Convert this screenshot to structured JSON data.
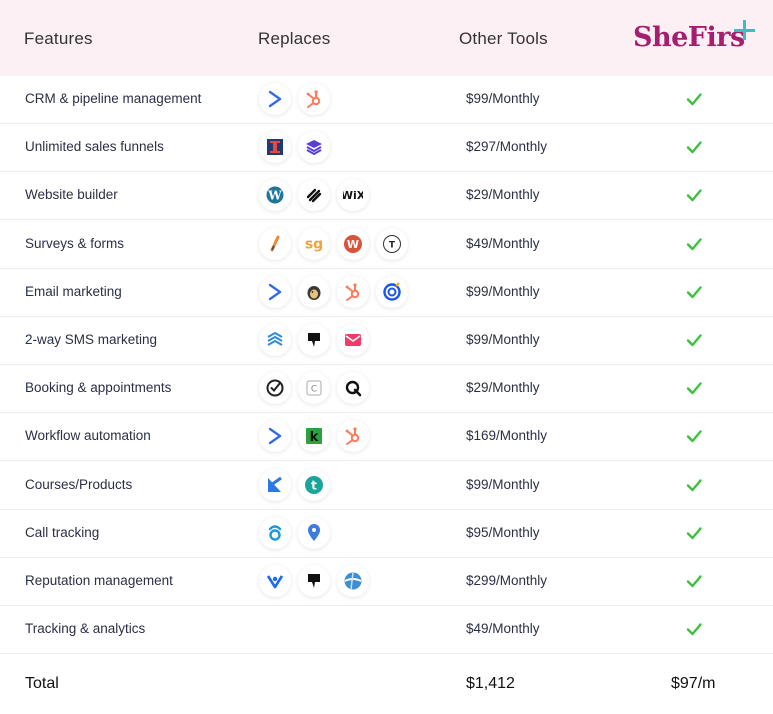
{
  "header": {
    "features": "Features",
    "replaces": "Replaces",
    "other_tools": "Other Tools",
    "brand": "SheFirs"
  },
  "colors": {
    "header_bg": "#fdf0f4",
    "brand": "#a61f6e",
    "plus": "#33c2bd",
    "check": "#3cc13b"
  },
  "rows": [
    {
      "feature": "CRM & pipeline management",
      "price": "$99/Monthly",
      "icons": [
        "activecampaign-icon",
        "hubspot-icon"
      ]
    },
    {
      "feature": "Unlimited sales funnels",
      "price": "$297/Monthly",
      "icons": [
        "clickfunnels-icon",
        "leadpages-icon"
      ]
    },
    {
      "feature": "Website builder",
      "price": "$29/Monthly",
      "icons": [
        "wordpress-icon",
        "squarespace-icon",
        "wix-icon"
      ]
    },
    {
      "feature": "Surveys & forms",
      "price": "$49/Monthly",
      "icons": [
        "jotform-icon",
        "surveygizmo-icon",
        "wufoo-icon",
        "typeform-icon"
      ]
    },
    {
      "feature": "Email marketing",
      "price": "$99/Monthly",
      "icons": [
        "activecampaign-icon",
        "mailchimp-icon",
        "hubspot-icon",
        "constantcontact-icon"
      ]
    },
    {
      "feature": "2-way SMS marketing",
      "price": "$99/Monthly",
      "icons": [
        "textmagic-icon",
        "podium-icon",
        "simpletexting-icon"
      ]
    },
    {
      "feature": "Booking & appointments",
      "price": "$29/Monthly",
      "icons": [
        "acuity-icon",
        "calendly-icon",
        "qwilr-icon"
      ]
    },
    {
      "feature": "Workflow automation",
      "price": "$169/Monthly",
      "icons": [
        "activecampaign-icon",
        "keap-icon",
        "hubspot-icon"
      ]
    },
    {
      "feature": "Courses/Products",
      "price": "$99/Monthly",
      "icons": [
        "kajabi-icon",
        "teachable-icon"
      ]
    },
    {
      "feature": "Call tracking",
      "price": "$95/Monthly",
      "icons": [
        "callrail-icon",
        "calltrackingmetrics-icon"
      ]
    },
    {
      "feature": "Reputation management",
      "price": "$299/Monthly",
      "icons": [
        "birdeye-icon",
        "podium-icon",
        "yext-icon"
      ]
    },
    {
      "feature": "Tracking & analytics",
      "price": "$49/Monthly",
      "icons": []
    }
  ],
  "total": {
    "label": "Total",
    "other": "$1,412",
    "shefirst": "$97/m"
  },
  "icon_glyphs": {
    "wix": "WiX",
    "surveygizmo": "sg",
    "typeform": "T",
    "calendly": "C",
    "keap": "k",
    "teachable": "t"
  }
}
